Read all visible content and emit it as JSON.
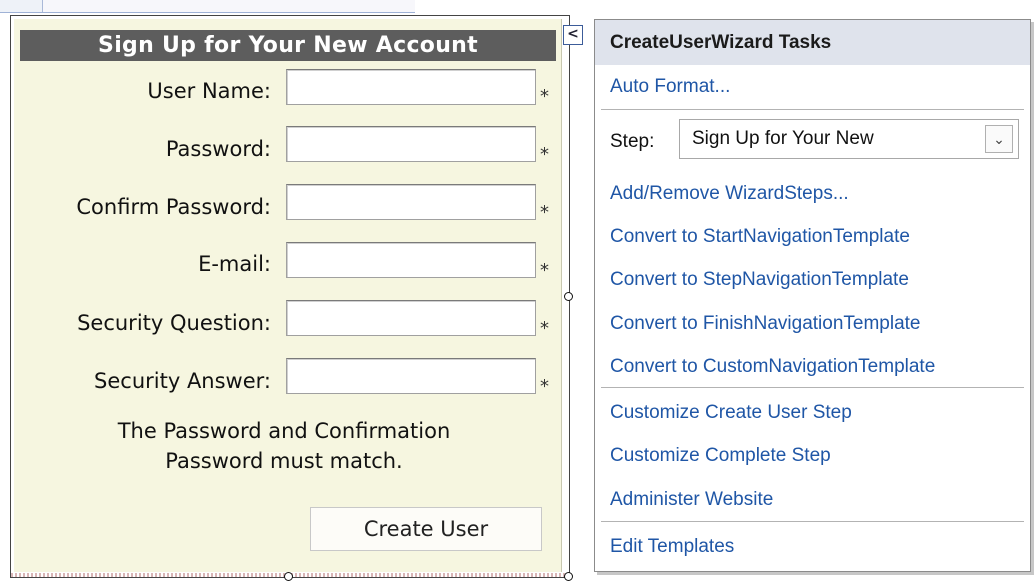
{
  "wizard": {
    "title": "Sign Up for Your New Account",
    "fields": [
      {
        "label": "User Name:",
        "required_mark": "*"
      },
      {
        "label": "Password:",
        "required_mark": "*"
      },
      {
        "label": "Confirm Password:",
        "required_mark": "*"
      },
      {
        "label": "E-mail:",
        "required_mark": "*"
      },
      {
        "label": "Security Question:",
        "required_mark": "*"
      },
      {
        "label": "Security Answer:",
        "required_mark": "*"
      }
    ],
    "message_line1": "The Password and Confirmation",
    "message_line2": "Password must match.",
    "create_button": "Create User",
    "background_color": "#f6f6e0",
    "title_bar_color": "#5d5d5d"
  },
  "smart_tag": {
    "glyph": "<"
  },
  "tasks_panel": {
    "title": "CreateUserWizard Tasks",
    "auto_format": "Auto Format...",
    "step_label": "Step:",
    "step_value": "Sign Up for Your New",
    "step_chevron": "⌄",
    "links": [
      "Add/Remove WizardSteps...",
      "Convert to StartNavigationTemplate",
      "Convert to StepNavigationTemplate",
      "Convert to FinishNavigationTemplate",
      "Convert to CustomNavigationTemplate"
    ],
    "links2": [
      "Customize Create User Step",
      "Customize Complete Step",
      "Administer Website"
    ],
    "edit_templates": "Edit Templates",
    "link_color": "#1f56a6",
    "header_color": "#dfe3ec"
  }
}
